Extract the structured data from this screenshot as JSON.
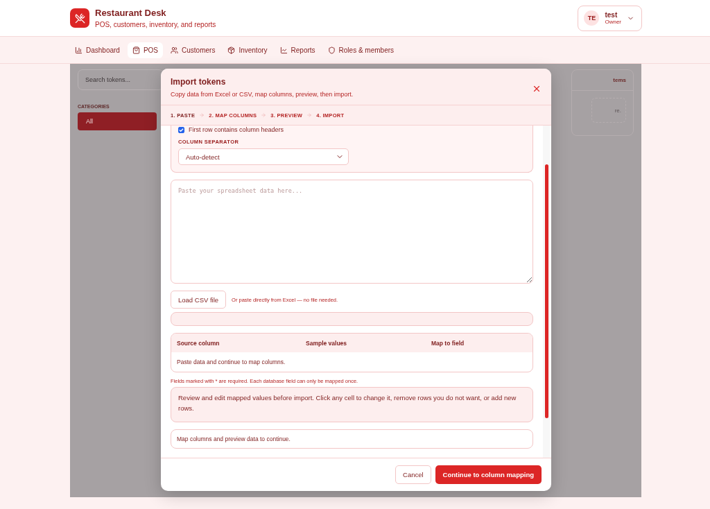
{
  "app": {
    "title": "Restaurant Desk",
    "subtitle": "POS, customers, inventory, and reports"
  },
  "user": {
    "initials": "TE",
    "name": "test",
    "role": "Owner"
  },
  "nav": [
    {
      "label": "Dashboard",
      "kind": "chart",
      "selected": false
    },
    {
      "label": "POS",
      "kind": "bag",
      "selected": true
    },
    {
      "label": "Customers",
      "kind": "users",
      "selected": false
    },
    {
      "label": "Inventory",
      "kind": "box",
      "selected": false
    },
    {
      "label": "Reports",
      "kind": "line",
      "selected": false
    },
    {
      "label": "Roles & members",
      "kind": "shield",
      "selected": false
    }
  ],
  "background": {
    "search_placeholder": "Search tokens...",
    "categories_label": "CATEGORIES",
    "categories": [
      {
        "label": "All",
        "selected": true
      }
    ],
    "card_header": "tems",
    "card_note": "re."
  },
  "dialog": {
    "title": "Import tokens",
    "subtitle": "Copy data from Excel or CSV, map columns, preview, then import.",
    "steps": [
      {
        "label": "1. PASTE",
        "selected": true
      },
      {
        "label": "2. MAP COLUMNS",
        "selected": false
      },
      {
        "label": "3. PREVIEW",
        "selected": false
      },
      {
        "label": "4. IMPORT",
        "selected": false
      }
    ],
    "header_checkbox": {
      "label": "First row contains column headers",
      "checked": true
    },
    "separator_label": "COLUMN SEPARATOR",
    "separator_value": "Auto-detect",
    "paste_placeholder": "Paste your spreadsheet data here...",
    "load_button": "Load CSV file",
    "load_hint": "Or paste directly from Excel — no file needed.",
    "mapping_table": {
      "columns": [
        "Source column",
        "Sample values",
        "Map to field"
      ],
      "empty": "Paste data and continue to map columns."
    },
    "mapping_note": "Fields marked with * are required. Each database field can only be mapped once.",
    "preview_info": "Review and edit mapped values before import. Click any cell to change it, remove rows you do not want, or add new rows.",
    "status": "Map columns and preview data to continue.",
    "buttons": {
      "cancel": "Cancel",
      "primary": "Continue to column mapping"
    }
  }
}
